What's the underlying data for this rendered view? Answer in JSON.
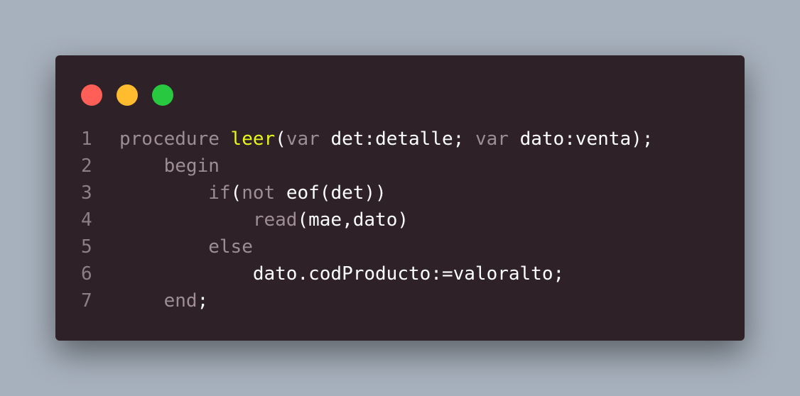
{
  "colors": {
    "background": "#a7b1bd",
    "window": "#2e2228",
    "close": "#ff5f57",
    "minimize": "#febc2e",
    "maximize": "#28c840",
    "keyword": "#9e8d95",
    "function": "#e6f51c",
    "text": "#ffffff",
    "line_number": "#8d7f86"
  },
  "code": {
    "lines": [
      {
        "number": "1",
        "indent": "",
        "tokens": [
          {
            "text": "procedure ",
            "kind": "kw"
          },
          {
            "text": "leer",
            "kind": "fn"
          },
          {
            "text": "(",
            "kind": "tx"
          },
          {
            "text": "var ",
            "kind": "kw"
          },
          {
            "text": "det:detalle; ",
            "kind": "tx"
          },
          {
            "text": "var ",
            "kind": "kw"
          },
          {
            "text": "dato:venta);",
            "kind": "tx"
          }
        ]
      },
      {
        "number": "2",
        "indent": "    ",
        "tokens": [
          {
            "text": "begin",
            "kind": "kw"
          }
        ]
      },
      {
        "number": "3",
        "indent": "        ",
        "tokens": [
          {
            "text": "if",
            "kind": "kw"
          },
          {
            "text": "(",
            "kind": "tx"
          },
          {
            "text": "not ",
            "kind": "kw"
          },
          {
            "text": "eof(det))",
            "kind": "tx"
          }
        ]
      },
      {
        "number": "4",
        "indent": "            ",
        "tokens": [
          {
            "text": "read",
            "kind": "kw"
          },
          {
            "text": "(mae,dato)",
            "kind": "tx"
          }
        ]
      },
      {
        "number": "5",
        "indent": "        ",
        "tokens": [
          {
            "text": "else",
            "kind": "kw"
          }
        ]
      },
      {
        "number": "6",
        "indent": "            ",
        "tokens": [
          {
            "text": "dato.codProducto:=valoralto;",
            "kind": "tx"
          }
        ]
      },
      {
        "number": "7",
        "indent": "    ",
        "tokens": [
          {
            "text": "end",
            "kind": "kw"
          },
          {
            "text": ";",
            "kind": "tx"
          }
        ]
      }
    ]
  }
}
